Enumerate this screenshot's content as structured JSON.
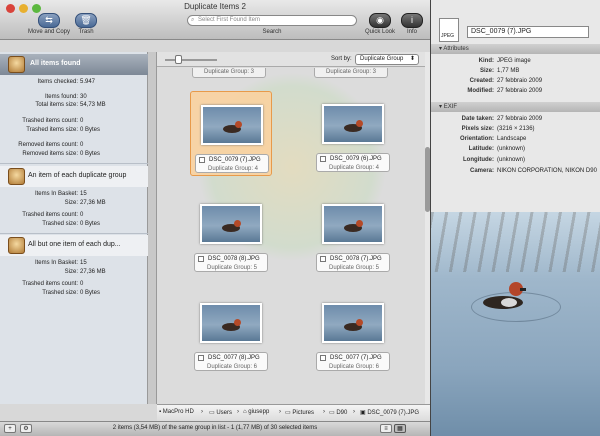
{
  "window": {
    "title": "Duplicate Items 2"
  },
  "toolbar": {
    "move_copy": "Move and Copy",
    "trash": "Trash",
    "search_placeholder": "Select First Found Item",
    "search_label": "Search",
    "quick_look": "Quick Look",
    "info": "Info"
  },
  "sidebar": {
    "all_found": {
      "title": "All items found",
      "stats": [
        {
          "label": "Items checked:",
          "value": "5.947"
        },
        {
          "label": "Items found:",
          "value": "30"
        },
        {
          "label": "Total items size:",
          "value": "54,73 MB"
        },
        {
          "label": "Trashed items count:",
          "value": "0"
        },
        {
          "label": "Trashed items size:",
          "value": "0 Bytes"
        },
        {
          "label": "Removed items count:",
          "value": "0"
        },
        {
          "label": "Removed items size:",
          "value": "0 Bytes"
        }
      ]
    },
    "each_group": {
      "title": "An item of each duplicate group",
      "stats": [
        {
          "label": "Items In Basket:",
          "value": "15"
        },
        {
          "label": "Size:",
          "value": "27,36 MB"
        },
        {
          "label": "Trashed items count:",
          "value": "0"
        },
        {
          "label": "Trashed size:",
          "value": "0 Bytes"
        }
      ]
    },
    "all_but_one": {
      "title": "All but one item of each dup...",
      "stats": [
        {
          "label": "Items In Basket:",
          "value": "15"
        },
        {
          "label": "Size:",
          "value": "27,36 MB"
        },
        {
          "label": "Trashed items count:",
          "value": "0"
        },
        {
          "label": "Trashed size:",
          "value": "0 Bytes"
        }
      ]
    }
  },
  "sort": {
    "label": "Sort by:",
    "value": "Duplicate Group"
  },
  "grid": {
    "top_group": "Duplicate Group: 3",
    "items": [
      {
        "name": "DSC_0079 (7).JPG",
        "group": "Duplicate Group: 4"
      },
      {
        "name": "DSC_0079 (6).JPG",
        "group": "Duplicate Group: 4"
      },
      {
        "name": "DSC_0078 (8).JPG",
        "group": "Duplicate Group: 5"
      },
      {
        "name": "DSC_0078 (7).JPG",
        "group": "Duplicate Group: 5"
      },
      {
        "name": "DSC_0077 (8).JPG",
        "group": "Duplicate Group: 6"
      },
      {
        "name": "DSC_0077 (7).JPG",
        "group": "Duplicate Group: 6"
      }
    ]
  },
  "path": [
    "MacPro HD",
    "Users",
    "giusepp",
    "Pictures",
    "D90",
    "DSC_0079 (7).JPG"
  ],
  "status": "2 items (3,54 MB) of the same group in list - 1 (1,77 MB) of 30 selected items",
  "info_panel": {
    "filename": "DSC_0079 (7).JPG",
    "file_icon_label": "JPEG",
    "attributes_header": "Attributes",
    "attributes": [
      {
        "label": "Kind:",
        "value": "JPEG image"
      },
      {
        "label": "Size:",
        "value": "1,77 MB"
      },
      {
        "label": "Created:",
        "value": "27 febbraio 2009"
      },
      {
        "label": "Modified:",
        "value": "27 febbraio 2009"
      }
    ],
    "exif_header": "EXIF",
    "exif": [
      {
        "label": "Date taken:",
        "value": "27 febbraio 2009"
      },
      {
        "label": "Pixels size:",
        "value": "(3216 × 2136)"
      },
      {
        "label": "Orientation:",
        "value": "Landscape"
      },
      {
        "label": "Latitude:",
        "value": "(unknown)"
      },
      {
        "label": "Longitude:",
        "value": "(unknown)"
      },
      {
        "label": "Camera:",
        "value": "NIKON CORPORATION, NIKON D90"
      }
    ]
  },
  "colors": {
    "selection": "#f8c890",
    "sidebar_header": "#8c96a3"
  }
}
